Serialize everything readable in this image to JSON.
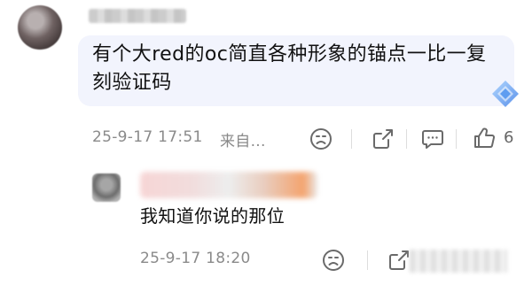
{
  "main_comment": {
    "text": "有个大red的oc简直各种形象的锚点一比一复刻验证码",
    "time": "25-9-17 17:51",
    "source": "来自...",
    "like_count": "6"
  },
  "reply": {
    "text": "我知道你说的那位",
    "time": "25-9-17 18:20"
  },
  "colors": {
    "bubble_bg": "#f2f4fd",
    "meta_text": "#8a8a8a",
    "gem_blue": "#4d8fe8"
  },
  "icons": [
    "sad-face-icon",
    "share-icon",
    "comment-icon",
    "like-icon",
    "diamond-badge-icon"
  ]
}
